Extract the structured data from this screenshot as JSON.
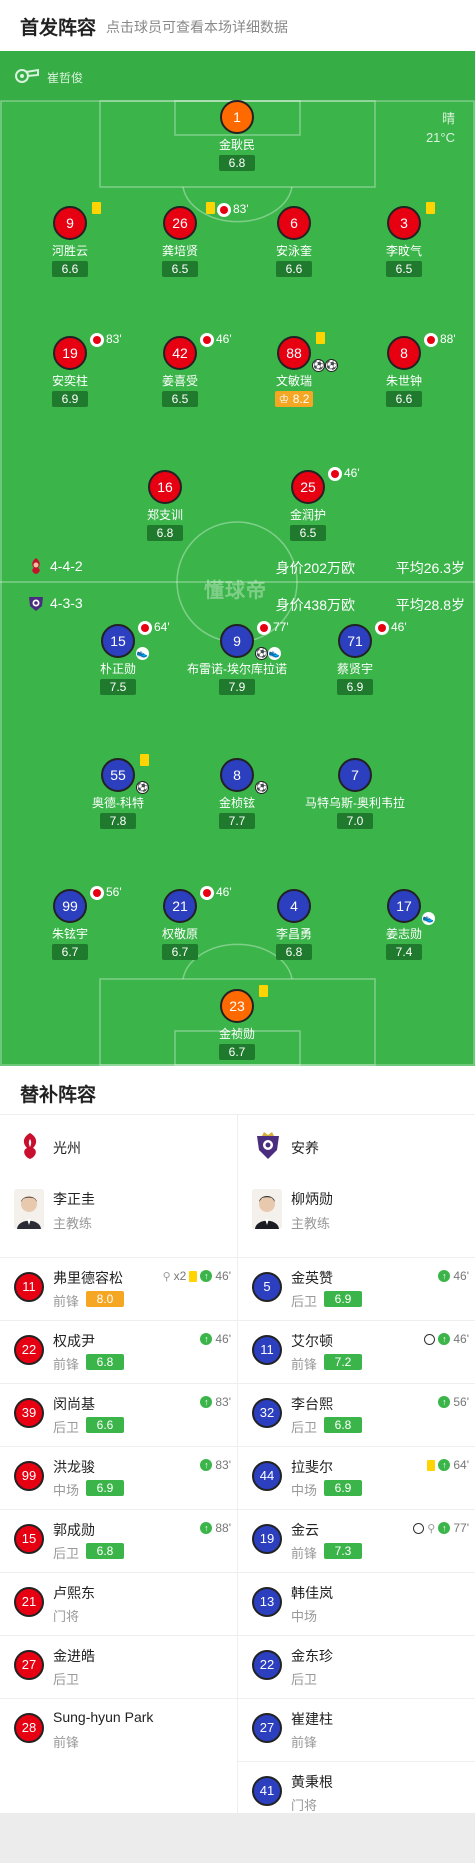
{
  "header": {
    "title": "首发阵容",
    "subtitle": "点击球员可查看本场详细数据"
  },
  "referee": {
    "name": "崔哲俊"
  },
  "weather": {
    "condition": "晴",
    "temperature": "21°C"
  },
  "watermark": "懂球帝",
  "home_team": {
    "name": "光州",
    "formation": "4-4-2",
    "value": "身价202万欧",
    "avg_age": "平均26.3岁",
    "color": "#e60012"
  },
  "away_team": {
    "name": "安养",
    "formation": "4-3-3",
    "value": "身价438万欧",
    "avg_age": "平均28.8岁",
    "color": "#2b3fbf"
  },
  "home_players": [
    {
      "num": "1",
      "name": "金耿民",
      "rating": "6.8",
      "gk": true
    },
    {
      "num": "9",
      "name": "河胜云",
      "rating": "6.6",
      "yellow": true
    },
    {
      "num": "26",
      "name": "龚培贤",
      "rating": "6.5",
      "yellow": true,
      "sub_out": "83'"
    },
    {
      "num": "6",
      "name": "安泳奎",
      "rating": "6.6"
    },
    {
      "num": "3",
      "name": "李旼气",
      "rating": "6.5",
      "yellow": true
    },
    {
      "num": "19",
      "name": "安奕柱",
      "rating": "6.9",
      "sub_out": "83'"
    },
    {
      "num": "42",
      "name": "姜喜受",
      "rating": "6.5",
      "sub_out": "46'"
    },
    {
      "num": "88",
      "name": "文敏瑞",
      "rating": "8.2",
      "best": true,
      "yellow": true,
      "goals": 2
    },
    {
      "num": "8",
      "name": "朱世钟",
      "rating": "6.6",
      "sub_out": "88'"
    },
    {
      "num": "16",
      "name": "郑支训",
      "rating": "6.8"
    },
    {
      "num": "25",
      "name": "金润护",
      "rating": "6.5",
      "sub_out": "46'"
    }
  ],
  "away_players": [
    {
      "num": "15",
      "name": "朴正勋",
      "rating": "7.5",
      "sub_out": "64'",
      "assist": true
    },
    {
      "num": "9",
      "name": "布雷诺-埃尔库拉诺",
      "rating": "7.9",
      "sub_out": "77'",
      "goal": true,
      "assist": true
    },
    {
      "num": "71",
      "name": "蔡贤宇",
      "rating": "6.9",
      "sub_out": "46'"
    },
    {
      "num": "55",
      "name": "奥德-科特",
      "rating": "7.8",
      "yellow": true,
      "goal": true
    },
    {
      "num": "8",
      "name": "金桢铉",
      "rating": "7.7",
      "goal": true
    },
    {
      "num": "7",
      "name": "马特乌斯-奥利韦拉",
      "rating": "7.0"
    },
    {
      "num": "99",
      "name": "朱铉宇",
      "rating": "6.7",
      "sub_out": "56'"
    },
    {
      "num": "21",
      "name": "权敬原",
      "rating": "6.7",
      "sub_out": "46'"
    },
    {
      "num": "4",
      "name": "李昌勇",
      "rating": "6.8"
    },
    {
      "num": "17",
      "name": "姜志勋",
      "rating": "7.4",
      "assist": true
    },
    {
      "num": "23",
      "name": "金祯勋",
      "rating": "6.7",
      "gk": true,
      "yellow": true
    }
  ],
  "subs": {
    "title": "替补阵容",
    "coach_role": "主教练",
    "home": {
      "team_name": "光州",
      "coach": "李正圭",
      "players": [
        {
          "num": "11",
          "name": "弗里德容松",
          "pos": "前锋",
          "rating": "8.0",
          "best": true,
          "assists": "x2",
          "yellow": true,
          "sub_in": "46'"
        },
        {
          "num": "22",
          "name": "权成尹",
          "pos": "前锋",
          "rating": "6.8",
          "sub_in": "46'"
        },
        {
          "num": "39",
          "name": "闵尚基",
          "pos": "后卫",
          "rating": "6.6",
          "sub_in": "83'"
        },
        {
          "num": "99",
          "name": "洪龙骏",
          "pos": "中场",
          "rating": "6.9",
          "sub_in": "83'"
        },
        {
          "num": "15",
          "name": "郭成勋",
          "pos": "后卫",
          "rating": "6.8",
          "sub_in": "88'"
        },
        {
          "num": "21",
          "name": "卢熙东",
          "pos": "门将"
        },
        {
          "num": "27",
          "name": "金进皓",
          "pos": "后卫"
        },
        {
          "num": "28",
          "name": "Sung-hyun Park",
          "pos": "前锋"
        }
      ]
    },
    "away": {
      "team_name": "安养",
      "coach": "柳炳勋",
      "players": [
        {
          "num": "5",
          "name": "金英赞",
          "pos": "后卫",
          "rating": "6.9",
          "sub_in": "46'"
        },
        {
          "num": "11",
          "name": "艾尔顿",
          "pos": "前锋",
          "rating": "7.2",
          "goal": true,
          "sub_in": "46'"
        },
        {
          "num": "32",
          "name": "李台熙",
          "pos": "后卫",
          "rating": "6.8",
          "sub_in": "56'"
        },
        {
          "num": "44",
          "name": "拉斐尔",
          "pos": "中场",
          "rating": "6.9",
          "yellow": true,
          "sub_in": "64'"
        },
        {
          "num": "19",
          "name": "金云",
          "pos": "前锋",
          "rating": "7.3",
          "goal": true,
          "assist": true,
          "sub_in": "77'"
        },
        {
          "num": "13",
          "name": "韩佳岚",
          "pos": "中场"
        },
        {
          "num": "22",
          "name": "金东珍",
          "pos": "后卫"
        },
        {
          "num": "27",
          "name": "崔建柱",
          "pos": "前锋"
        },
        {
          "num": "41",
          "name": "黄秉根",
          "pos": "门将"
        }
      ]
    }
  }
}
